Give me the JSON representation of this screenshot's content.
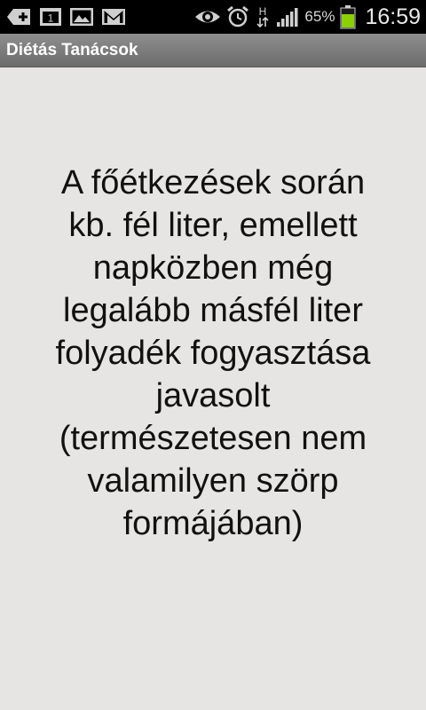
{
  "status_bar": {
    "notification_icons": [
      "add-icon",
      "calendar-icon",
      "gallery-icon",
      "gmail-icon"
    ],
    "system_icons": [
      "eye-icon",
      "alarm-icon",
      "hspa-data-icon",
      "signal-icon",
      "battery-icon"
    ],
    "calendar_day": "1",
    "network_type": "H",
    "battery_percent": "65%",
    "battery_color": "#8bd000",
    "time": "16:59"
  },
  "app": {
    "title": "Diétás Tanácsok"
  },
  "content": {
    "advice_text": "A főétkezések során\nkb. fél liter, emellett\nnapközben még\nlegalább másfél liter\nfolyadék fogyasztása\njavasolt\n(természetesen nem\nvalamilyen szörp\nformájában)"
  },
  "colors": {
    "background": "#e6e5e3",
    "titlebar": "#7d7d7d",
    "statusbar": "#000000"
  }
}
